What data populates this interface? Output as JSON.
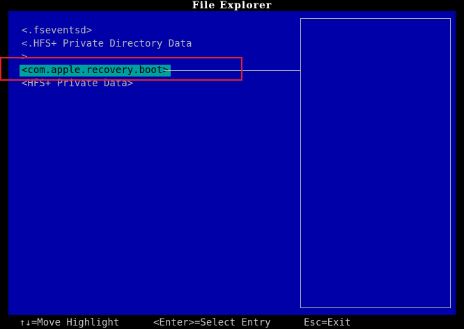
{
  "window": {
    "title": "File Explorer"
  },
  "entries": [
    {
      "label": "<.fseventsd>",
      "selected": false
    },
    {
      "label": "<.HFS+ Private Directory Data",
      "selected": false
    },
    {
      "label": ">",
      "selected": false
    },
    {
      "label": "<com.apple.recovery.boot>",
      "selected": true
    },
    {
      "label": "<HFS+ Private Data>",
      "selected": false
    }
  ],
  "footer": {
    "move": "↑↓=Move Highlight",
    "enter": "<Enter>=Select Entry",
    "exit": "Esc=Exit"
  },
  "colors": {
    "panel_background": "#0000a8",
    "selection": "#00a0a0",
    "annotation_box": "#e8202a"
  }
}
